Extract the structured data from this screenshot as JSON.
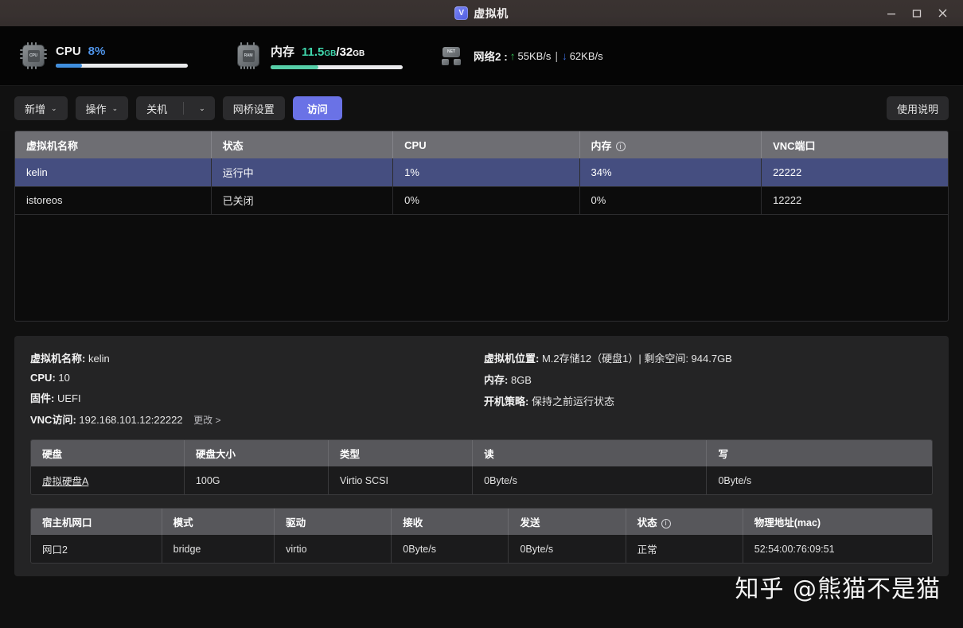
{
  "window": {
    "title": "虚拟机",
    "icon": "shield-v-icon",
    "minimize": "—",
    "maximize": "▢",
    "close": "✕"
  },
  "stats": {
    "cpu": {
      "label": "CPU",
      "value": "8%",
      "percent": 20,
      "icon": "cpu-chip-icon",
      "chip_text": "CPU"
    },
    "memory": {
      "label": "内存",
      "used": "11.5",
      "used_unit": "GB",
      "sep": "/",
      "total": "32",
      "total_unit": "GB",
      "percent": 36,
      "icon": "ram-chip-icon",
      "chip_text": "RAM"
    },
    "network": {
      "label": "网络2 :",
      "up_arrow": "↑",
      "up_value": "55KB/s",
      "pipe": "|",
      "down_arrow": "↓",
      "down_value": "62KB/s",
      "icon": "network-icon",
      "chip_text": "NET"
    }
  },
  "toolbar": {
    "add_label": "新增",
    "action_label": "操作",
    "shutdown_label": "关机",
    "bridge_label": "网桥设置",
    "access_label": "访问",
    "help_label": "使用说明",
    "caret": "⌄",
    "accent_color": "#6a72e6"
  },
  "vm_table": {
    "columns": [
      "虚拟机名称",
      "状态",
      "CPU",
      "内存",
      "VNC端口"
    ],
    "memory_has_info_icon": true,
    "rows": [
      {
        "name": "kelin",
        "status": "运行中",
        "cpu": "1%",
        "memory": "34%",
        "vnc_port": "22222",
        "selected": true
      },
      {
        "name": "istoreos",
        "status": "已关闭",
        "cpu": "0%",
        "memory": "0%",
        "vnc_port": "12222",
        "selected": false
      }
    ],
    "selected_row_color": "#454e80"
  },
  "details": {
    "left": [
      {
        "label": "虚拟机名称:",
        "value": "kelin"
      },
      {
        "label": "CPU:",
        "value": "10"
      },
      {
        "label": "固件:",
        "value": "UEFI"
      },
      {
        "label": "VNC访问:",
        "value": "192.168.101.12:22222",
        "link": "更改 >"
      }
    ],
    "right": [
      {
        "label": "虚拟机位置:",
        "value": "M.2存储12（硬盘1）| 剩余空间: 944.7GB"
      },
      {
        "label": "内存:",
        "value": "8GB"
      },
      {
        "label": "开机策略:",
        "value": "保持之前运行状态"
      }
    ]
  },
  "disk_table": {
    "columns": [
      "硬盘",
      "硬盘大小",
      "类型",
      "读",
      "写"
    ],
    "rows": [
      {
        "disk": "虚拟硬盘A",
        "size": "100G",
        "type": "Virtio SCSI",
        "read": "0Byte/s",
        "write": "0Byte/s"
      }
    ]
  },
  "net_table": {
    "columns": [
      "宿主机网口",
      "模式",
      "驱动",
      "接收",
      "发送",
      "状态",
      "物理地址(mac)"
    ],
    "status_has_info_icon": true,
    "rows": [
      {
        "port": "网口2",
        "mode": "bridge",
        "driver": "virtio",
        "rx": "0Byte/s",
        "tx": "0Byte/s",
        "status": "正常",
        "mac": "52:54:00:76:09:51"
      }
    ]
  },
  "watermark": {
    "text": "知乎 @熊猫不是猫"
  }
}
